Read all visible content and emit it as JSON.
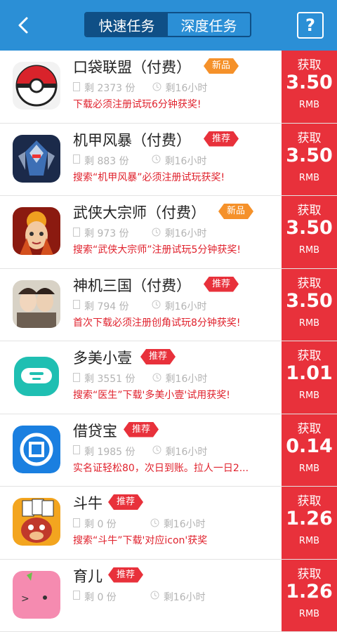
{
  "header": {
    "tabs": [
      {
        "label": "快速任务",
        "active": true
      },
      {
        "label": "深度任务",
        "active": false
      }
    ],
    "help_label": "?"
  },
  "colors": {
    "nav_blue": "#2b8fd6",
    "tab_dark": "#0f4f86",
    "reward_red": "#e8313b",
    "badge_orange": "#f5912a",
    "desc_red": "#e0222d"
  },
  "tasks": [
    {
      "title": "口袋联盟（付费）",
      "badge": "新品",
      "badge_type": "new",
      "remaining": "剩 2373 份",
      "time": "剩16小时",
      "desc": "下载必须注册试玩6分钟获奖!",
      "reward_label": "获取",
      "amount": "3.50",
      "unit": "RMB",
      "icon": "pokeball-icon"
    },
    {
      "title": "机甲风暴（付费）",
      "badge": "推荐",
      "badge_type": "rec",
      "remaining": "剩 883 份",
      "time": "剩16小时",
      "desc": "搜索“机甲风暴”必须注册试玩获奖!",
      "reward_label": "获取",
      "amount": "3.50",
      "unit": "RMB",
      "icon": "mecha-icon"
    },
    {
      "title": "武侠大宗师（付费）",
      "badge": "新品",
      "badge_type": "new",
      "remaining": "剩 973 份",
      "time": "剩16小时",
      "desc": "搜索“武侠大宗师”注册试玩5分钟获奖!",
      "reward_label": "获取",
      "amount": "3.50",
      "unit": "RMB",
      "icon": "warrior-icon"
    },
    {
      "title": "神机三国（付费）",
      "badge": "推荐",
      "badge_type": "rec",
      "remaining": "剩 794 份",
      "time": "剩16小时",
      "desc": "首次下载必须注册创角试玩8分钟获奖!",
      "reward_label": "获取",
      "amount": "3.50",
      "unit": "RMB",
      "icon": "three-kingdoms-icon"
    },
    {
      "title": "多美小壹",
      "badge": "推荐",
      "badge_type": "rec",
      "remaining": "剩 3551 份",
      "time": "剩16小时",
      "desc": "搜索“医生”下载'多美小壹'试用获奖!",
      "reward_label": "获取",
      "amount": "1.01",
      "unit": "RMB",
      "icon": "robot-face-icon"
    },
    {
      "title": "借贷宝",
      "badge": "推荐",
      "badge_type": "rec",
      "remaining": "剩 1985 份",
      "time": "剩16小时",
      "desc": "实名证轻松80，次日到账。拉人一日2...",
      "reward_label": "获取",
      "amount": "0.14",
      "unit": "RMB",
      "icon": "coin-icon"
    },
    {
      "title": "斗牛",
      "badge": "推荐",
      "badge_type": "rec",
      "remaining": "剩 0 份",
      "time": "剩16小时",
      "desc": "搜索“斗牛”下载'对应icon'获奖",
      "reward_label": "获取",
      "amount": "1.26",
      "unit": "RMB",
      "icon": "bull-cards-icon"
    },
    {
      "title": "育儿",
      "badge": "推荐",
      "badge_type": "rec",
      "remaining": "剩 0 份",
      "time": "剩16小时",
      "desc": "",
      "reward_label": "获取",
      "amount": "1.26",
      "unit": "RMB",
      "icon": "pink-face-icon"
    }
  ]
}
